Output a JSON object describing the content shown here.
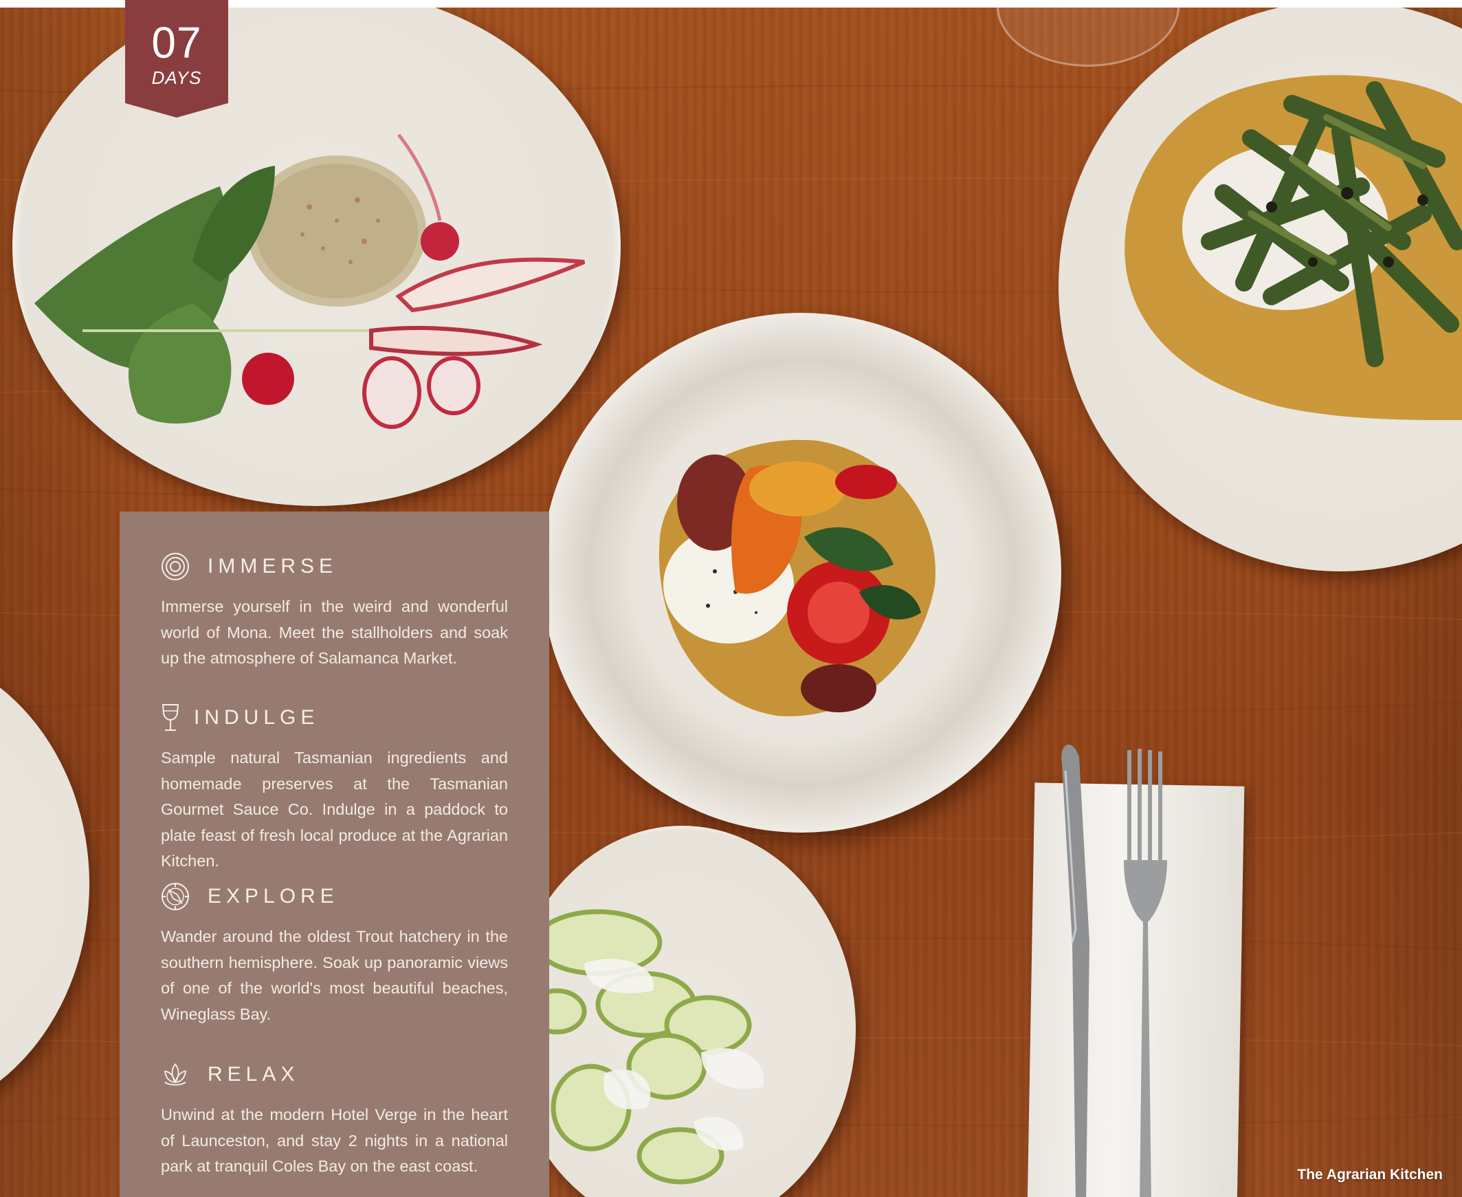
{
  "badge": {
    "number": "07",
    "label": "DAYS"
  },
  "sections": [
    {
      "icon": "concentric-circles-icon",
      "title": "IMMERSE",
      "body": "Immerse yourself in the weird and wonderful world of Mona. Meet the stallholders and soak up the atmosphere of Salamanca Market."
    },
    {
      "icon": "wine-glass-icon",
      "title": "INDULGE",
      "body": "Sample natural Tasmanian ingredients and homemade preserves at the Tasmanian Gourmet Sauce Co. Indulge in a paddock to plate feast of fresh local produce at the Agrarian Kitchen."
    },
    {
      "icon": "compass-icon",
      "title": "EXPLORE",
      "body": "Wander around the oldest Trout hatchery in the southern hemisphere. Soak up panoramic views of one of the world's most beautiful beaches, Wineglass Bay."
    },
    {
      "icon": "lotus-icon",
      "title": "RELAX",
      "body": "Unwind at the modern Hotel Verge in the heart of Launceston, and stay 2 nights in a national park at tranquil Coles Bay on the east coast."
    }
  ],
  "photo": {
    "caption": "The Agrarian Kitchen",
    "table_color": "#9a4a1c"
  },
  "colors": {
    "badge": "#8a3d3f",
    "panel": "#977b70",
    "panel_text": "#f6efe9"
  }
}
